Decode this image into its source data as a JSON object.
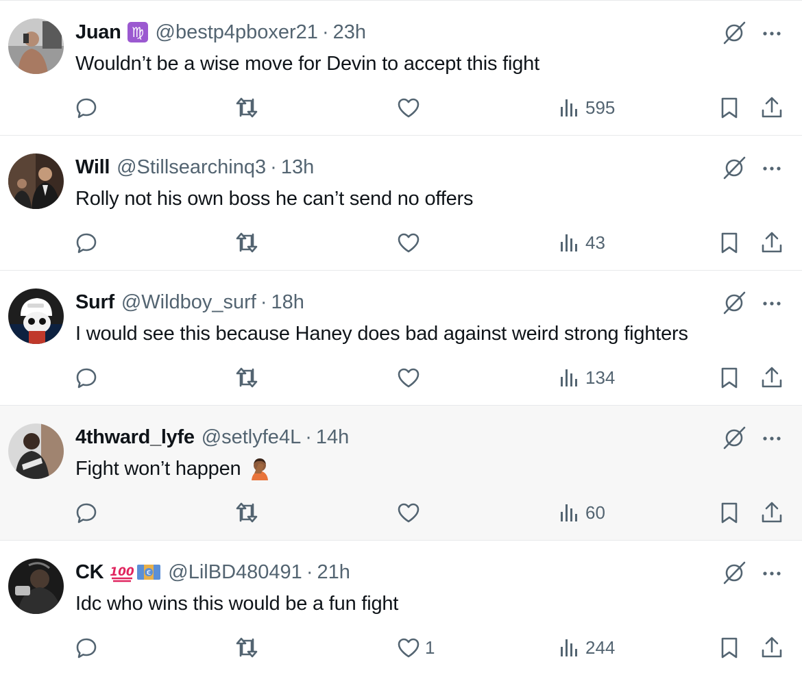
{
  "tweets": [
    {
      "name": "Juan",
      "badges": [
        "virgo-emoji-icon"
      ],
      "handle": "@bestp4pboxer21",
      "time": "23h",
      "text": "Wouldn’t be a wise move for Devin to accept this fight",
      "emoji": "",
      "likes": "",
      "views": "595",
      "hover": false
    },
    {
      "name": "Will",
      "badges": [],
      "handle": "@Stillsearchinq3",
      "time": "13h",
      "text": "Rolly not his own boss he can’t send no offers",
      "emoji": "",
      "likes": "",
      "views": "43",
      "hover": false
    },
    {
      "name": "Surf",
      "badges": [],
      "handle": "@Wildboy_surf",
      "time": "18h",
      "text": "I would see this because Haney does bad against weird strong fighters",
      "emoji": "",
      "likes": "",
      "views": "134",
      "hover": false
    },
    {
      "name": "4thward_lyfe",
      "badges": [],
      "handle": "@setlyfe4L",
      "time": "14h",
      "text": "Fight won’t happen",
      "emoji": "facepalm-emoji-icon",
      "likes": "",
      "views": "60",
      "hover": true
    },
    {
      "name": "CK",
      "badges": [
        "hundred-emoji-icon",
        "euro-banknote-emoji-icon"
      ],
      "handle": "@LilBD480491",
      "time": "21h",
      "text": "Idc who wins this would be a fun fight",
      "emoji": "",
      "likes": "1",
      "views": "244",
      "hover": false
    }
  ],
  "separator": "·",
  "colors": {
    "text": "#0f1419",
    "secondary": "#536471",
    "border": "#e7e9eb",
    "hover_bg": "#f7f7f7"
  }
}
